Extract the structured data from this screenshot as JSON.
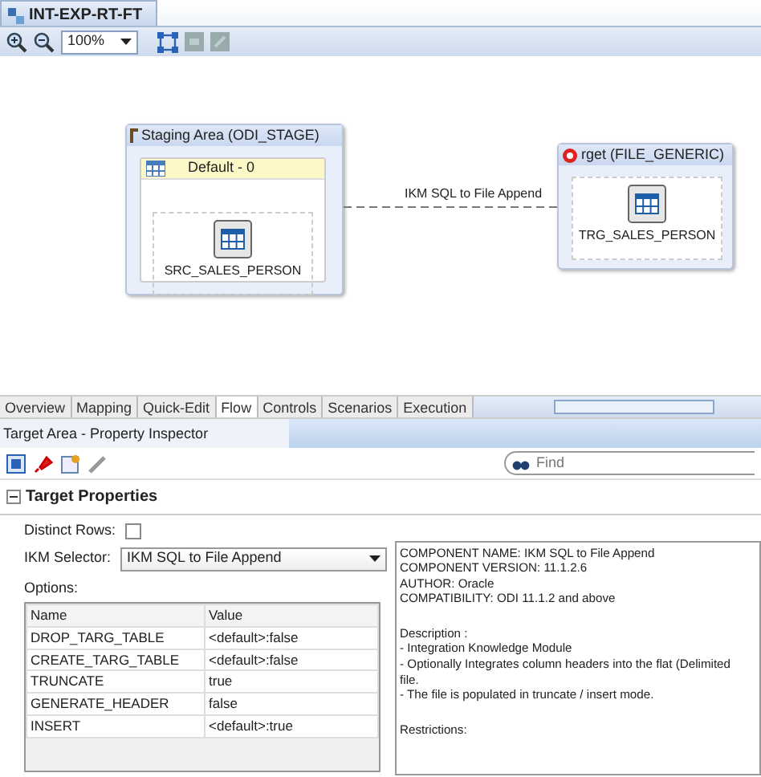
{
  "editor_tab": {
    "label": "INT-EXP-RT-FT",
    "selected": true
  },
  "zoom": {
    "value": "100%"
  },
  "diagram": {
    "staging": {
      "title": "Staging Area (ODI_STAGE)",
      "group": "Default - 0",
      "node": "SRC_SALES_PERSON"
    },
    "target": {
      "title": "rget (FILE_GENERIC)",
      "node": "TRG_SALES_PERSON"
    },
    "connector_label": "IKM SQL to File Append"
  },
  "tabs": [
    {
      "label": "Overview",
      "selected": false
    },
    {
      "label": "Mapping",
      "selected": false
    },
    {
      "label": "Quick-Edit",
      "selected": false
    },
    {
      "label": "Flow",
      "selected": true
    },
    {
      "label": "Controls",
      "selected": false
    },
    {
      "label": "Scenarios",
      "selected": false
    },
    {
      "label": "Execution",
      "selected": false
    }
  ],
  "inspector": {
    "title": "Target Area - Property Inspector",
    "find_placeholder": "Find",
    "section": "Target Properties",
    "expanded": true,
    "distinct_rows": {
      "label": "Distinct Rows:",
      "checked": false
    },
    "ikm": {
      "label": "IKM Selector:",
      "value": "IKM SQL to File Append"
    },
    "options_label": "Options:",
    "columns": [
      "Name",
      "Value"
    ],
    "rows": [
      [
        "DROP_TARG_TABLE",
        "<default>:false"
      ],
      [
        "CREATE_TARG_TABLE",
        "<default>:false"
      ],
      [
        "TRUNCATE",
        "true"
      ],
      [
        "GENERATE_HEADER",
        "false"
      ],
      [
        "INSERT",
        "<default>:true"
      ]
    ],
    "description": [
      [
        "COMPONENT NAME: IKM SQL to File Append",
        "COMPONENT VERSION: 11.1.2.6",
        "AUTHOR: Oracle",
        "COMPATIBILITY: ODI 11.1.2 and above"
      ],
      [
        "Description :",
        "- Integration Knowledge Module",
        "- Optionally Integrates column headers into the flat (Delimited",
        "file.",
        "- The file is populated in truncate / insert mode."
      ],
      [
        "Restrictions:"
      ]
    ]
  }
}
